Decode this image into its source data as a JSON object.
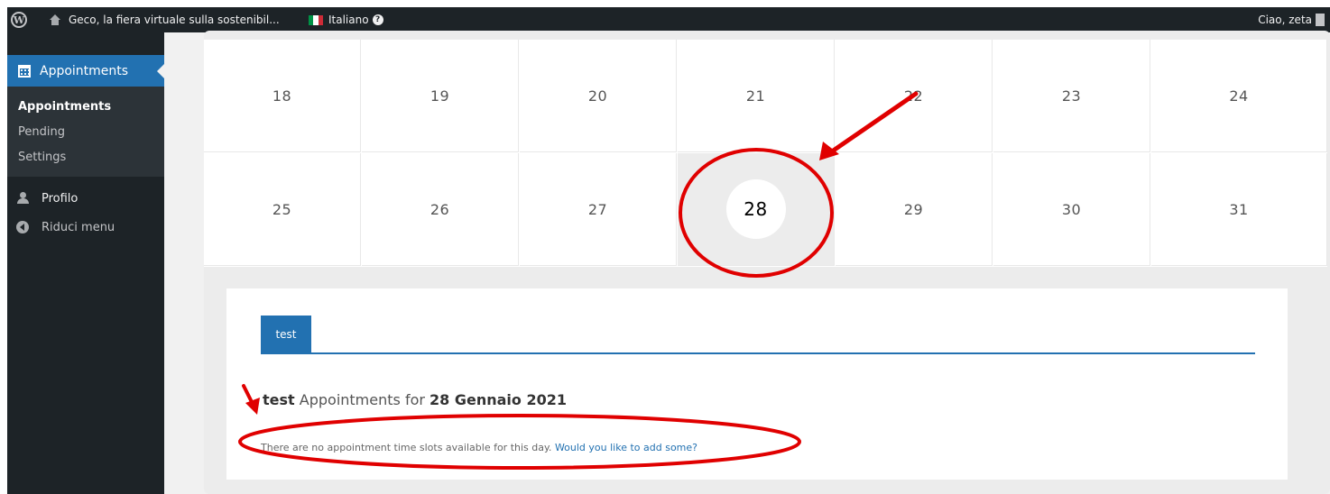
{
  "adminbar": {
    "site_name": "Geco, la fiera virtuale sulla sostenibil...",
    "language": "Italiano",
    "greeting": "Ciao, zeta",
    "flag_colors": [
      "#009246",
      "#ffffff",
      "#ce2b37"
    ]
  },
  "sidebar": {
    "current_menu": "Appointments",
    "submenu": [
      "Appointments",
      "Pending",
      "Settings"
    ],
    "profile": "Profilo",
    "collapse": "Riduci menu"
  },
  "calendar": {
    "weeks": [
      [
        "18",
        "19",
        "20",
        "21",
        "22",
        "23",
        "24"
      ],
      [
        "25",
        "26",
        "27",
        "28",
        "29",
        "30",
        "31"
      ]
    ],
    "selected_day": "28"
  },
  "details": {
    "tab_label": "test",
    "heading_calendar": "test",
    "heading_middle": "Appointments for",
    "heading_date": "28 Gennaio 2021",
    "no_slots_text": "There are no appointment time slots available for this day.",
    "add_link": "Would you like to add some?"
  },
  "colors": {
    "accent": "#2271b1",
    "adminbar_bg": "#1d2327",
    "annotation_red": "#e00000"
  }
}
